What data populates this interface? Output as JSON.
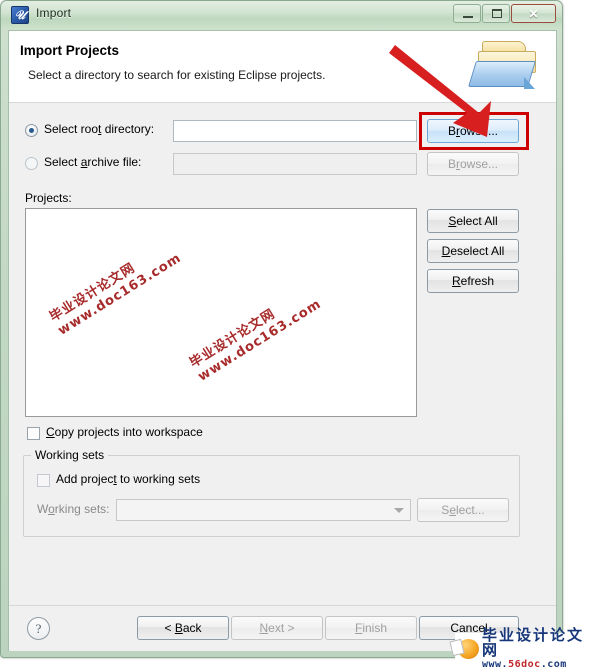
{
  "window": {
    "title": "Import",
    "icon": "eclipse-icon",
    "controls": {
      "minimize": "minimize-icon",
      "maximize": "maximize-icon",
      "close": "✕"
    }
  },
  "header": {
    "title": "Import Projects",
    "subtitle": "Select a directory to search for existing Eclipse projects.",
    "icon": "import-folder-icon"
  },
  "source": {
    "root_directory": {
      "label_pre": "Select roo",
      "label_accel": "t",
      "label_post": " directory:",
      "selected": true,
      "value": "",
      "browse_label_pre": "B",
      "browse_label_accel": "r",
      "browse_label_post": "owse..."
    },
    "archive_file": {
      "label_pre": "Select ",
      "label_accel": "a",
      "label_post": "rchive file:",
      "selected": false,
      "value": "",
      "browse_label_pre": "B",
      "browse_label_accel": "r",
      "browse_label_post": "owse..."
    }
  },
  "projects": {
    "label": "Projects:",
    "items": [],
    "buttons": {
      "select_all_pre": "",
      "select_all_accel": "S",
      "select_all_post": "elect All",
      "deselect_all_pre": "",
      "deselect_all_accel": "D",
      "deselect_all_post": "eselect All",
      "refresh_pre": "",
      "refresh_accel": "R",
      "refresh_post": "efresh"
    }
  },
  "options": {
    "copy_projects": {
      "pre": "",
      "accel": "C",
      "post": "opy projects into workspace",
      "checked": false
    }
  },
  "working_sets": {
    "group_title": "Working sets",
    "add_project": {
      "pre": "Add projec",
      "accel": "t",
      "post": " to working sets",
      "checked": false,
      "enabled": false
    },
    "combo_label_pre": "W",
    "combo_label_accel": "o",
    "combo_label_post": "rking sets:",
    "combo_value": "",
    "select_button_pre": "S",
    "select_button_accel": "e",
    "select_button_post": "lect..."
  },
  "footer": {
    "help": "?",
    "back_pre": "< ",
    "back_accel": "B",
    "back_post": "ack",
    "next_pre": "",
    "next_accel": "N",
    "next_post": "ext >",
    "finish_pre": "",
    "finish_accel": "F",
    "finish_post": "inish",
    "cancel": "Cancel"
  },
  "annotations": {
    "highlight_target": "browse-root-directory-button",
    "arrow_color": "#cc0000",
    "highlight_color": "#cc0000"
  },
  "watermarks": {
    "diagonal_line1": "毕业设计论文网",
    "diagonal_line2": "www.doc163.com",
    "logo_cn": "毕业设计论文网",
    "logo_url_prefix": "www.",
    "logo_url_red": "56doc",
    "logo_url_suffix": ".com"
  }
}
